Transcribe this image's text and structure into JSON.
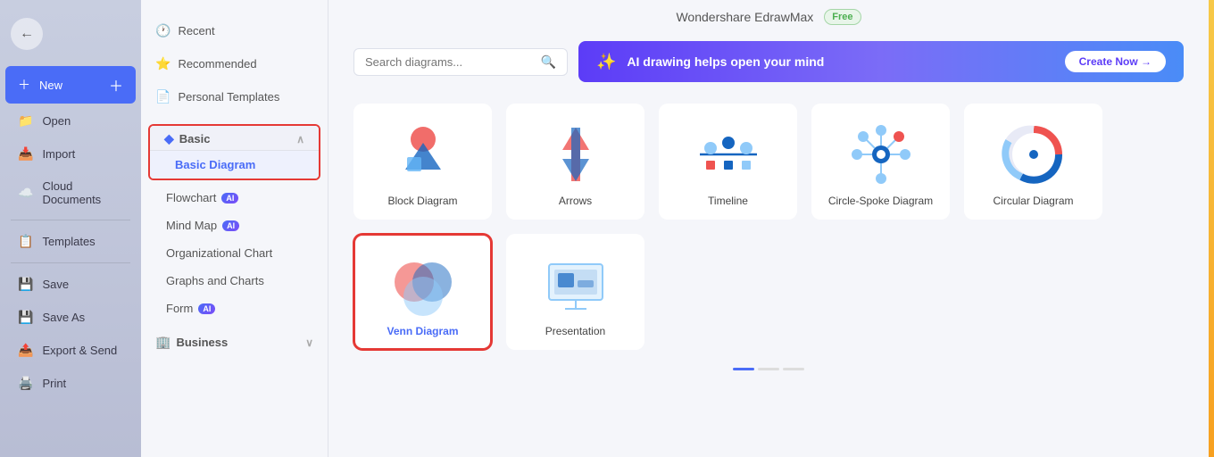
{
  "app": {
    "title": "Wondershare EdrawMax",
    "free_badge": "Free"
  },
  "sidebar": {
    "items": [
      {
        "id": "new",
        "label": "New",
        "icon": "➕",
        "active": true
      },
      {
        "id": "open",
        "label": "Open",
        "icon": "📁"
      },
      {
        "id": "import",
        "label": "Import",
        "icon": "📥"
      },
      {
        "id": "cloud",
        "label": "Cloud Documents",
        "icon": "☁️"
      },
      {
        "id": "templates",
        "label": "Templates",
        "icon": "📋"
      },
      {
        "id": "save",
        "label": "Save",
        "icon": "💾"
      },
      {
        "id": "saveas",
        "label": "Save As",
        "icon": "💾"
      },
      {
        "id": "export",
        "label": "Export & Send",
        "icon": "📤"
      },
      {
        "id": "print",
        "label": "Print",
        "icon": "🖨️"
      }
    ]
  },
  "nav": {
    "top_items": [
      {
        "id": "recent",
        "label": "Recent",
        "icon": "🕐"
      },
      {
        "id": "recommended",
        "label": "Recommended",
        "icon": "⭐"
      },
      {
        "id": "personal",
        "label": "Personal Templates",
        "icon": "📄"
      }
    ],
    "sections": [
      {
        "id": "basic",
        "label": "Basic",
        "expanded": true,
        "sub_items": [
          {
            "id": "basic-diagram",
            "label": "Basic Diagram",
            "active": true,
            "ai": false
          },
          {
            "id": "flowchart",
            "label": "Flowchart",
            "ai": true
          },
          {
            "id": "mind-map",
            "label": "Mind Map",
            "ai": true
          },
          {
            "id": "org-chart",
            "label": "Organizational Chart",
            "ai": false
          },
          {
            "id": "graphs-charts",
            "label": "Graphs and Charts",
            "ai": false
          },
          {
            "id": "form",
            "label": "Form",
            "ai": true
          }
        ]
      },
      {
        "id": "business",
        "label": "Business",
        "expanded": false
      }
    ]
  },
  "search": {
    "placeholder": "Search diagrams..."
  },
  "ai_banner": {
    "icon": "✨",
    "text": "AI drawing helps open your mind",
    "button_label": "Create Now →"
  },
  "diagrams": {
    "cards": [
      {
        "id": "block-diagram",
        "label": "Block Diagram",
        "selected": false
      },
      {
        "id": "arrows",
        "label": "Arrows",
        "selected": false
      },
      {
        "id": "timeline",
        "label": "Timeline",
        "selected": false
      },
      {
        "id": "circle-spoke",
        "label": "Circle-Spoke Diagram",
        "selected": false
      },
      {
        "id": "circular-diagram",
        "label": "Circular Diagram",
        "selected": false
      },
      {
        "id": "venn-diagram",
        "label": "Venn Diagram",
        "selected": true
      },
      {
        "id": "presentation",
        "label": "Presentation",
        "selected": false
      }
    ]
  }
}
